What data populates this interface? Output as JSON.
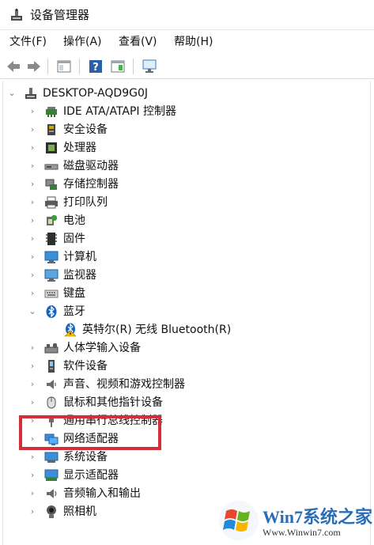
{
  "window": {
    "title": "设备管理器"
  },
  "menu": [
    {
      "label": "文件(F)"
    },
    {
      "label": "操作(A)"
    },
    {
      "label": "查看(V)"
    },
    {
      "label": "帮助(H)"
    }
  ],
  "toolbar": {
    "icons": [
      "back-arrow-icon",
      "forward-arrow-icon",
      "properties-panel-icon",
      "help-icon",
      "action-pane-icon",
      "scan-hardware-icon"
    ]
  },
  "tree": {
    "root": {
      "label": "DESKTOP-AQD9G0J",
      "expanded": true,
      "icon": "computer-icon"
    },
    "items": [
      {
        "label": "IDE ATA/ATAPI 控制器",
        "icon": "ide-controller-icon",
        "expanded": false
      },
      {
        "label": "安全设备",
        "icon": "security-device-icon",
        "expanded": false
      },
      {
        "label": "处理器",
        "icon": "processor-icon",
        "expanded": false
      },
      {
        "label": "磁盘驱动器",
        "icon": "disk-drive-icon",
        "expanded": false
      },
      {
        "label": "存储控制器",
        "icon": "storage-controller-icon",
        "expanded": false
      },
      {
        "label": "打印队列",
        "icon": "printer-icon",
        "expanded": false
      },
      {
        "label": "电池",
        "icon": "battery-icon",
        "expanded": false
      },
      {
        "label": "固件",
        "icon": "firmware-icon",
        "expanded": false
      },
      {
        "label": "计算机",
        "icon": "monitor-icon",
        "expanded": false
      },
      {
        "label": "监视器",
        "icon": "monitor-icon",
        "expanded": false
      },
      {
        "label": "键盘",
        "icon": "keyboard-icon",
        "expanded": false
      },
      {
        "label": "蓝牙",
        "icon": "bluetooth-icon",
        "expanded": true,
        "children": [
          {
            "label": "英特尔(R) 无线 Bluetooth(R)",
            "icon": "bluetooth-warning-icon"
          }
        ]
      },
      {
        "label": "人体学输入设备",
        "icon": "hid-icon",
        "expanded": false
      },
      {
        "label": "软件设备",
        "icon": "software-device-icon",
        "expanded": false
      },
      {
        "label": "声音、视频和游戏控制器",
        "icon": "speaker-icon",
        "expanded": false
      },
      {
        "label": "鼠标和其他指针设备",
        "icon": "mouse-icon",
        "expanded": false
      },
      {
        "label": "通用串行总线控制器",
        "icon": "usb-icon",
        "expanded": false
      },
      {
        "label": "网络适配器",
        "icon": "network-adapter-icon",
        "expanded": false
      },
      {
        "label": "系统设备",
        "icon": "system-device-icon",
        "expanded": false
      },
      {
        "label": "显示适配器",
        "icon": "display-adapter-icon",
        "expanded": false
      },
      {
        "label": "音频输入和输出",
        "icon": "audio-io-icon",
        "expanded": false
      },
      {
        "label": "照相机",
        "icon": "camera-icon",
        "expanded": false
      }
    ]
  },
  "watermark": {
    "brand": "Win7系统之家",
    "url": "Www.Winwin7.com"
  },
  "colors": {
    "highlight": "#d32e3a",
    "text": "#111111",
    "arrow": "#7a7a7a",
    "accent": "#2a6db7"
  }
}
